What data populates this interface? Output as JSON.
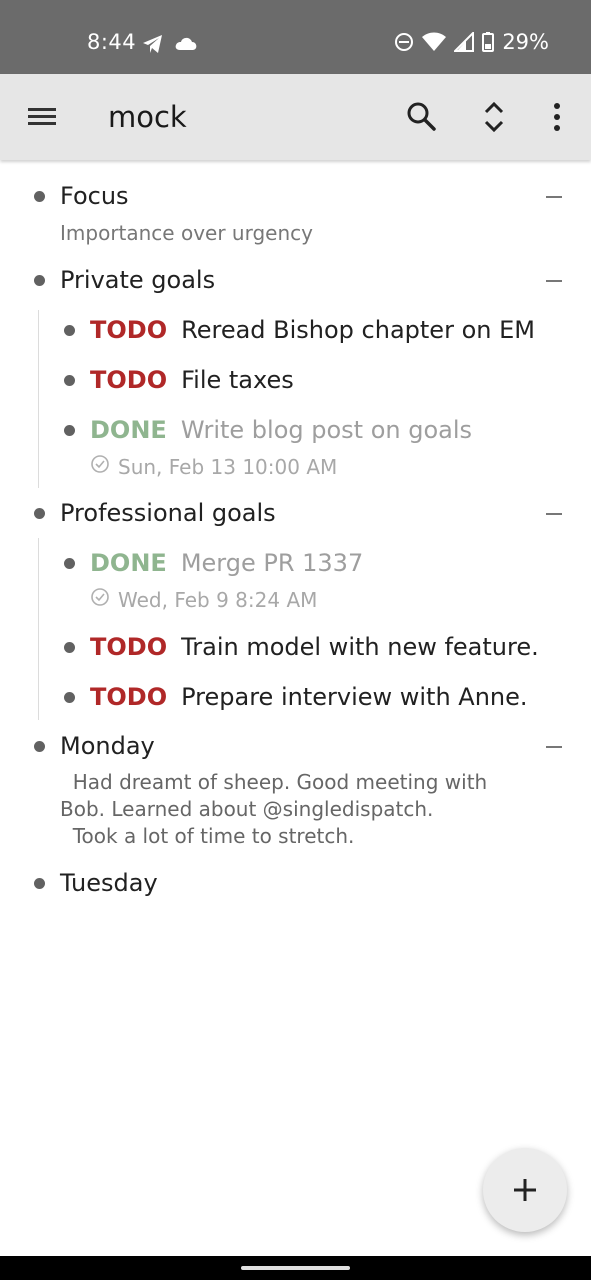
{
  "status_bar": {
    "time": "8:44",
    "battery": "29%",
    "icons": [
      "telegram-icon",
      "cloud-icon",
      "dnd-icon",
      "wifi-icon",
      "signal-icon",
      "battery-icon"
    ]
  },
  "app_bar": {
    "title": "mock",
    "icons": [
      "menu-icon",
      "search-icon",
      "expand-collapse-icon",
      "more-vert-icon"
    ]
  },
  "outline": {
    "focus": {
      "title": "Focus",
      "note": "Importance over urgency"
    },
    "private_goals": {
      "title": "Private goals",
      "items": [
        {
          "keyword": "TODO",
          "text": "Reread Bishop chapter on EM"
        },
        {
          "keyword": "TODO",
          "text": "File taxes"
        },
        {
          "keyword": "DONE",
          "text": "Write blog post on goals",
          "closed": "Sun, Feb 13 10:00 AM"
        }
      ]
    },
    "professional_goals": {
      "title": "Professional goals",
      "items": [
        {
          "keyword": "DONE",
          "text": "Merge PR 1337",
          "closed": "Wed, Feb 9 8:24 AM"
        },
        {
          "keyword": "TODO",
          "text": "Train model with new feature."
        },
        {
          "keyword": "TODO",
          "text": "Prepare interview with Anne."
        }
      ]
    },
    "monday": {
      "title": "Monday",
      "body_lines": [
        "  Had dreamt of sheep. Good meeting with",
        "Bob. Learned about @singledispatch.",
        "  Took a lot of time to stretch."
      ]
    },
    "tuesday": {
      "title": "Tuesday"
    }
  },
  "colors": {
    "todo": "#b02828",
    "done": "#8fb58f",
    "app_bar": "#e6e6e6",
    "status_bar": "#6b6b6b"
  }
}
